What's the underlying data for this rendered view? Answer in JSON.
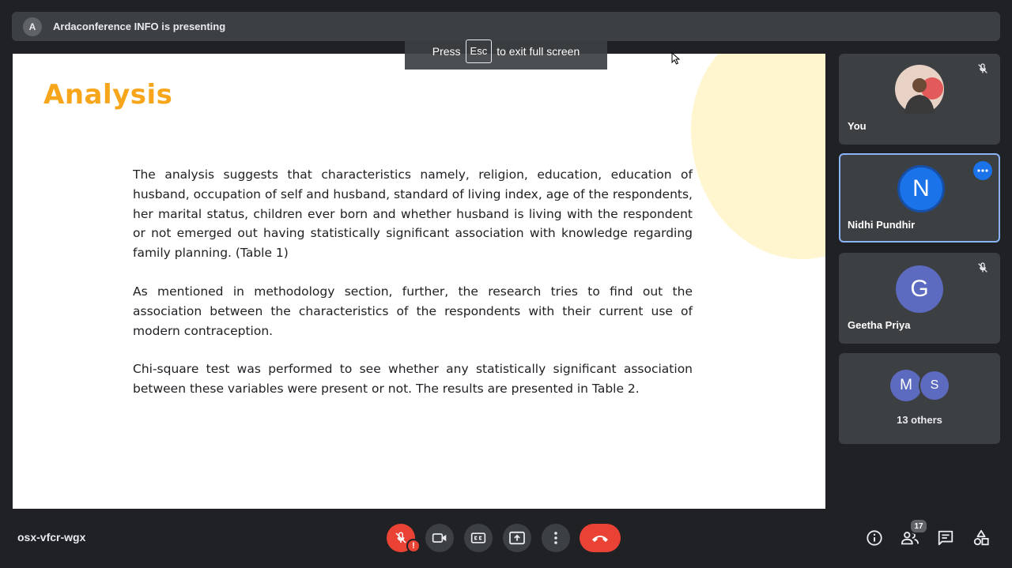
{
  "presenter_bar": {
    "avatar_letter": "A",
    "text": "Ardaconference INFO is presenting"
  },
  "fullscreen_toast": {
    "press": "Press",
    "key": "Esc",
    "suffix": "to exit full screen"
  },
  "slide": {
    "title": "Analysis",
    "paragraphs": [
      "The analysis suggests that characteristics namely, religion, education, education of husband, occupation of self and husband, standard of living index, age of the respondents, her marital status, children ever born and whether husband is living with the respondent or not emerged out having statistically significant association with knowledge regarding family planning. (Table 1)",
      "As mentioned in methodology section, further, the research tries to find out the association between the characteristics of the respondents with their current use of modern contraception.",
      "Chi-square test was performed to see whether any statistically significant association between these variables were present or not. The results are presented in Table 2."
    ]
  },
  "participants": [
    {
      "name": "You",
      "muted": true
    },
    {
      "name": "Nidhi Pundhir",
      "letter": "N",
      "color": "#1a73e8",
      "active": true
    },
    {
      "name": "Geetha Priya",
      "letter": "G",
      "color": "#5c6bc0",
      "muted": true
    }
  ],
  "others": {
    "letters": [
      "M",
      "S"
    ],
    "label": "13 others"
  },
  "bottom_bar": {
    "meeting_code": "osx-vfcr-wgx",
    "mic_alert": "!",
    "people_count": "17"
  },
  "colors": {
    "background": "#202124",
    "tile": "#3c4043",
    "title_accent": "#f7a61b",
    "danger": "#ea4335",
    "active_border": "#8ab4f8"
  }
}
